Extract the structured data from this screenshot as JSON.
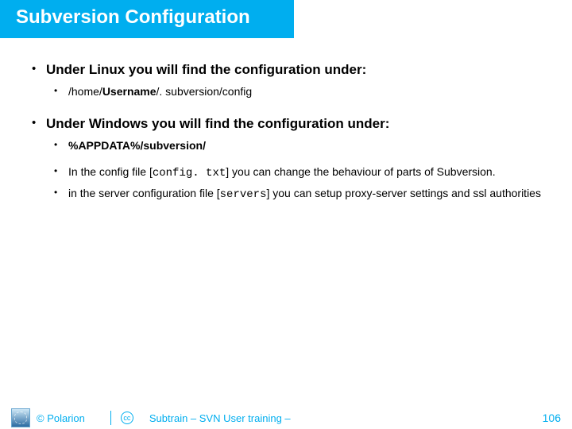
{
  "title": "Subversion Configuration",
  "bullets": [
    {
      "heading": "Under Linux you will find the configuration under:",
      "sub": [
        {
          "type": "path",
          "pre": "/home/",
          "bold": "Username",
          "post": "/. subversion/config"
        }
      ]
    },
    {
      "heading": "Under Windows you will find the configuration under:",
      "sub": [
        {
          "type": "pathbold",
          "text": "%APPDATA%/subversion/"
        },
        {
          "type": "inline",
          "p1": "In the config file [",
          "mono1": "config. txt",
          "p2": "] you can change the behaviour of parts of Subversion."
        },
        {
          "type": "inline",
          "p1": "in the server configuration file [",
          "mono1": "servers",
          "p2": "] you can setup proxy-server settings and ssl authorities"
        }
      ]
    }
  ],
  "footer": {
    "copyright": "© Polarion",
    "cc": "cc",
    "subtitle": "Subtrain – SVN User training –",
    "page": "106"
  }
}
